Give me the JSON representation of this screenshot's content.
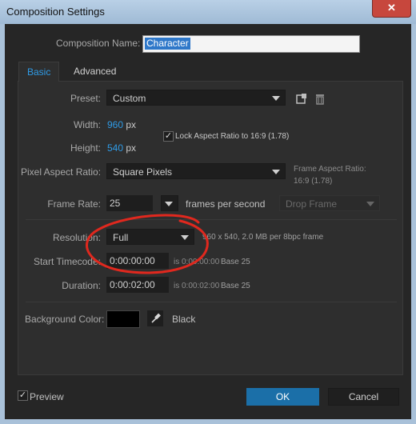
{
  "window": {
    "title": "Composition Settings",
    "close_glyph": "✕"
  },
  "name": {
    "label": "Composition Name:",
    "value": "Character"
  },
  "tabs": [
    {
      "label": "Basic"
    },
    {
      "label": "Advanced"
    }
  ],
  "preset": {
    "label": "Preset:",
    "value": "Custom"
  },
  "size": {
    "width_label": "Width:",
    "width_value": "960",
    "width_unit": "px",
    "height_label": "Height:",
    "height_value": "540",
    "height_unit": "px",
    "lock_label": "Lock Aspect Ratio to 16:9 (1.78)",
    "lock_checked": true
  },
  "pixel_aspect": {
    "label": "Pixel Aspect Ratio:",
    "value": "Square Pixels",
    "frame_aspect_line1": "Frame Aspect Ratio:",
    "frame_aspect_line2": "16:9 (1.78)"
  },
  "frame_rate": {
    "label": "Frame Rate:",
    "value": "25",
    "unit": "frames per second",
    "drop_frame": "Drop Frame"
  },
  "resolution": {
    "label": "Resolution:",
    "value": "Full",
    "info": "960 x 540, 2.0 MB per 8bpc frame"
  },
  "start_timecode": {
    "label": "Start Timecode:",
    "value": "0:00:00:00",
    "info": "is 0:00:00:00",
    "base": "Base 25"
  },
  "duration": {
    "label": "Duration:",
    "value": "0:00:02:00",
    "info": "is 0:00:02:00",
    "base": "Base 25"
  },
  "background": {
    "label": "Background Color:",
    "color": "#000000",
    "name": "Black"
  },
  "footer": {
    "preview_label": "Preview",
    "preview_checked": true,
    "ok": "OK",
    "cancel": "Cancel"
  },
  "colors": {
    "accent": "#2f9be6",
    "annotation": "#e0281e"
  },
  "icons": [
    "new-preset-icon",
    "trash-icon",
    "eyedropper-icon",
    "close-icon",
    "chevron-down-icon",
    "checkmark-icon"
  ]
}
